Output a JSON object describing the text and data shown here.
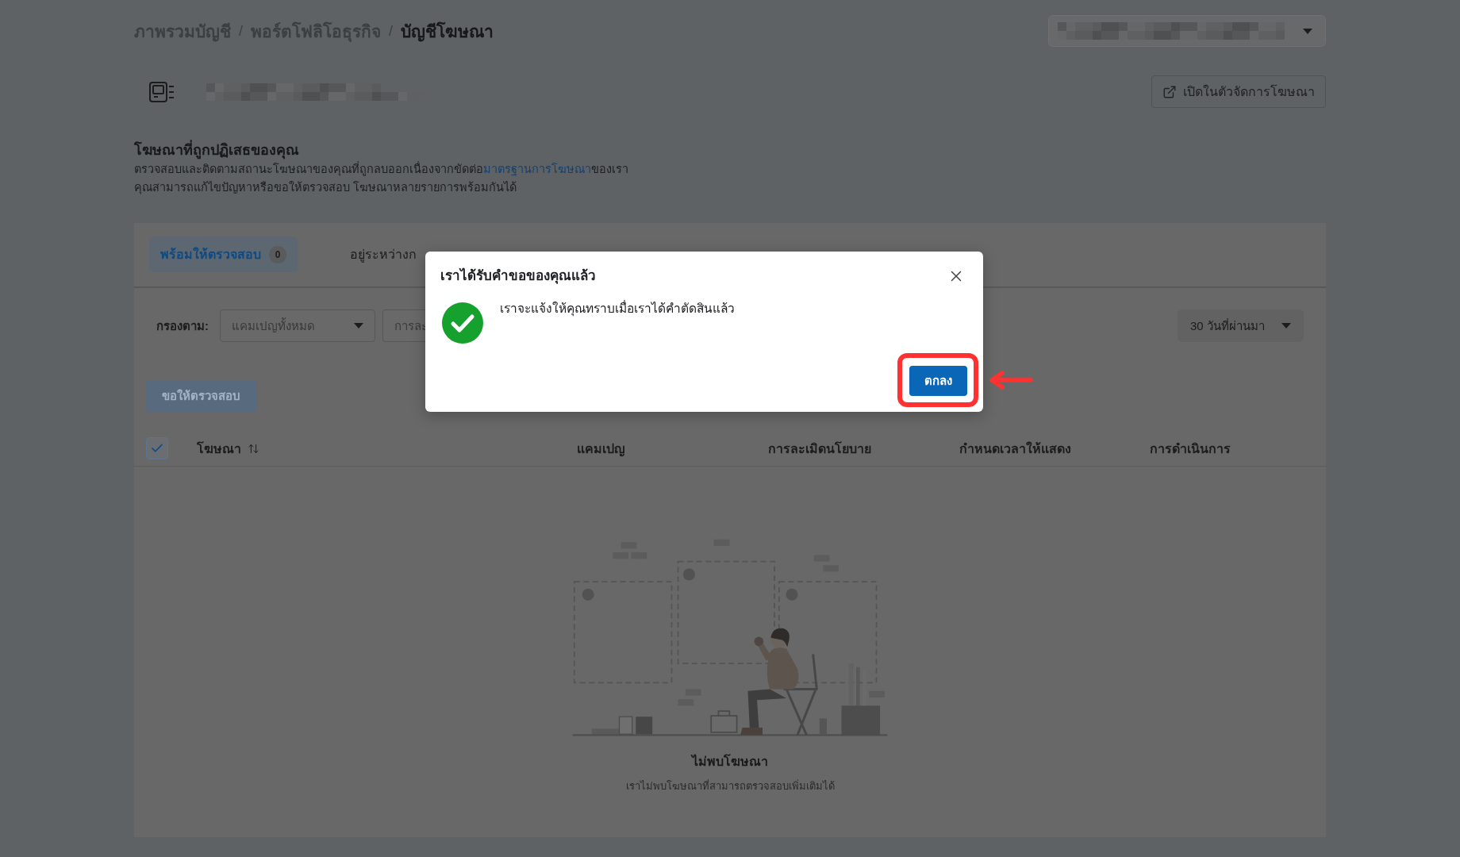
{
  "breadcrumb": {
    "items": [
      {
        "label": "ภาพรวมบัญชี",
        "current": false
      },
      {
        "label": "พอร์ตโฟลิโอธุรกิจ",
        "current": false
      },
      {
        "label": "บัญชีโฆษณา",
        "current": true
      }
    ],
    "separators": [
      "/",
      "/"
    ]
  },
  "account_selector": {
    "redacted": true
  },
  "account": {
    "redacted": true
  },
  "open_button": {
    "label": "เปิดในตัวจัดการโฆษณา"
  },
  "section": {
    "title": "โฆษณาที่ถูกปฏิเสธของคุณ",
    "description": {
      "before": "ตรวจสอบและติดตามสถานะโฆษณาของคุณที่ถูกลบออกเนื่องจากขัดต่อ",
      "link": "มาตรฐานการโฆษณา",
      "after": "ของเรา"
    },
    "note": "คุณสามารถแก้ไขปัญหาหรือขอให้ตรวจสอบ โฆษณาหลายรายการพร้อมกันได้"
  },
  "tabs": [
    {
      "label": "พร้อมให้ตรวจสอบ",
      "count": "0",
      "selected": true
    },
    {
      "label": "อยู่ระหว่างก",
      "selected": false
    }
  ],
  "filter": {
    "label": "กรองตาม:",
    "dropdowns": [
      {
        "value": "แคมเปญทั้งหมด"
      },
      {
        "value": "การละ"
      }
    ],
    "period": {
      "value": "30 วันที่ผ่านมา"
    }
  },
  "request_button": {
    "label": "ขอให้ตรวจสอบ",
    "disabled": true
  },
  "table": {
    "select_all": {
      "checked": true
    },
    "columns": [
      {
        "label": "โฆษณา",
        "sortable": true
      },
      {
        "label": "แคมเปญ",
        "sortable": false
      },
      {
        "label": "การละเมิดนโยบาย",
        "sortable": false
      },
      {
        "label": "กำหนดเวลาให้แสดง",
        "sortable": false
      },
      {
        "label": "การดำเนินการ",
        "sortable": false
      }
    ]
  },
  "empty_state": {
    "title": "ไม่พบโฆษณา",
    "message": "เราไม่พบโฆษณาที่สามารถตรวจสอบเพิ่มเติมได้"
  },
  "dialog": {
    "title": "เราได้รับคำขอของคุณแล้ว",
    "kind": "success",
    "message": "เราจะแจ้งให้คุณทราบเมื่อเราได้คำตัดสินแล้ว",
    "ok_button": {
      "label": "ตกลง",
      "highlighted": true
    }
  }
}
